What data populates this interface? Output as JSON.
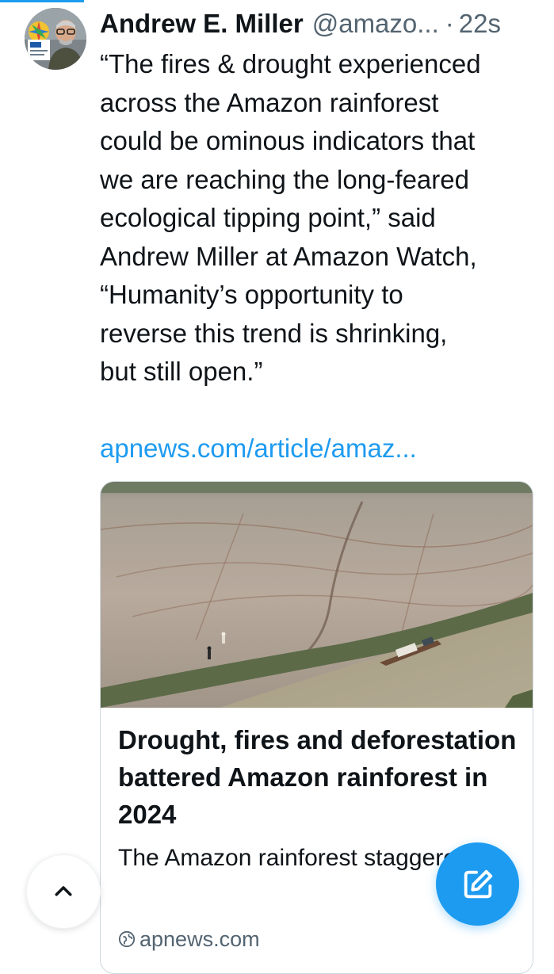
{
  "tweet": {
    "author_name": "Andrew E. Miller",
    "handle": "@amazo...",
    "separator": "·",
    "timestamp": "22s",
    "text": "“The fires & drought experienced\nacross the Amazon rainforest\ncould be ominous indicators that\nwe are reaching the long-feared\necological tipping point,” said\nAndrew Miller at Amazon Watch,\n“Humanity’s opportunity to\nreverse this trend is shrinking,\nbut still open.”",
    "link_text": "apnews.com/article/amaz..."
  },
  "card": {
    "title": "Drought, fires and deforestation battered Amazon rainforest in 2024",
    "description": "The Amazon rainforest staggered through another",
    "source": "apnews.com",
    "image_alt": "Aerial view of a dry, cracked riverbed with a small boat in the remaining channel"
  },
  "icons": {
    "avatar": "avatar",
    "source_icon": "globe-icon",
    "scroll_top_icon": "chevron-up-icon",
    "compose_icon": "compose-icon"
  },
  "colors": {
    "accent": "#1d9bf0",
    "secondary_text": "#536471",
    "primary_text": "#0f1419",
    "border": "#cfd9de"
  }
}
